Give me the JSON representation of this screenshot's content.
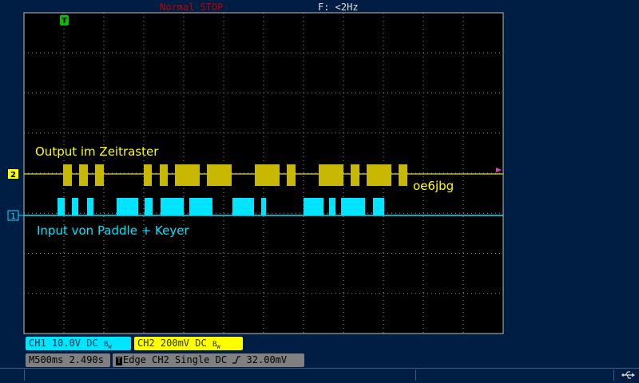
{
  "status": {
    "mode": "Normal  STOP",
    "frequency": "F: <2Hz"
  },
  "annotations": {
    "output_label": "Output im Zeitraster",
    "input_label": "Input von Paddle + Keyer",
    "callsign": "oe6jbg"
  },
  "markers": {
    "trigger_tag": "T",
    "ch2_tag": "2",
    "ch1_tag": "1"
  },
  "ch1": {
    "label": "CH1  10.0V  DC",
    "bw": "B",
    "bw_sub": "W",
    "color": "#00e5ff"
  },
  "ch2": {
    "label": "CH2  200mV  DC",
    "bw": "B",
    "bw_sub": "W",
    "color": "#c8b800"
  },
  "timebase": {
    "label": "M500ms 2.490s"
  },
  "trigger": {
    "icon": "T",
    "label": "Edge  CH2  Single  DC",
    "level": "32.00mV"
  },
  "colors": {
    "background": "#001d44",
    "grid": "#9a9a9a",
    "trigger_marker": "#00c000",
    "level_marker": "#e040c0"
  }
}
